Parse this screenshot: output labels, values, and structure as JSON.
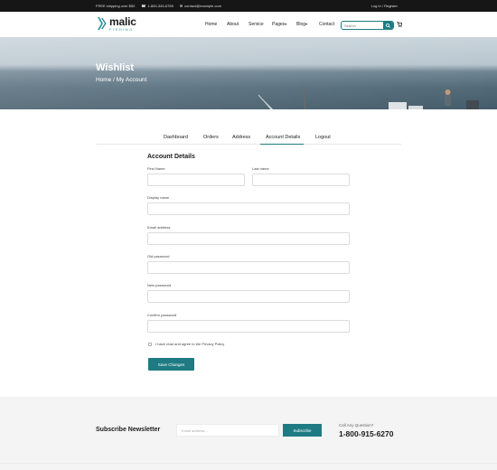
{
  "topbar": {
    "shipping": "FREE shipping over $50",
    "phone": "1-800-345-6789",
    "email": "contact@example.com",
    "account": "Log In / Register"
  },
  "header": {
    "logo_main": "malic",
    "logo_sub": "FISHING",
    "nav": {
      "home": "Home",
      "about": "About",
      "service": "Service",
      "pages": "Pages",
      "blog": "Blog",
      "contact": "Contact"
    },
    "search_placeholder": "Search"
  },
  "hero": {
    "title": "Wishlist",
    "breadcrumb": "Home / My Account"
  },
  "tabs": {
    "dashboard": "Dashboard",
    "orders": "Orders",
    "address": "Address",
    "account_details": "Account Details",
    "logout": "Logout",
    "active": "account_details"
  },
  "form": {
    "title": "Account Details",
    "first_name": "First Name",
    "last_name": "Last name",
    "display_name": "Display name",
    "email": "Email address",
    "old_password": "Old password",
    "new_password": "New password",
    "confirm_password": "Confirm password",
    "privacy": "I have read and agree to the Privacy Policy",
    "save": "Save Changes"
  },
  "newsletter": {
    "title": "Subscribe Newsletter",
    "placeholder": "Email address...",
    "button": "Subscribe",
    "call_label": "Call Any Question?",
    "call_number": "1-800-915-6270"
  },
  "colors": {
    "accent": "#1e7b83",
    "topbar": "#161616",
    "newsletter_bg": "#f4f4f4"
  }
}
